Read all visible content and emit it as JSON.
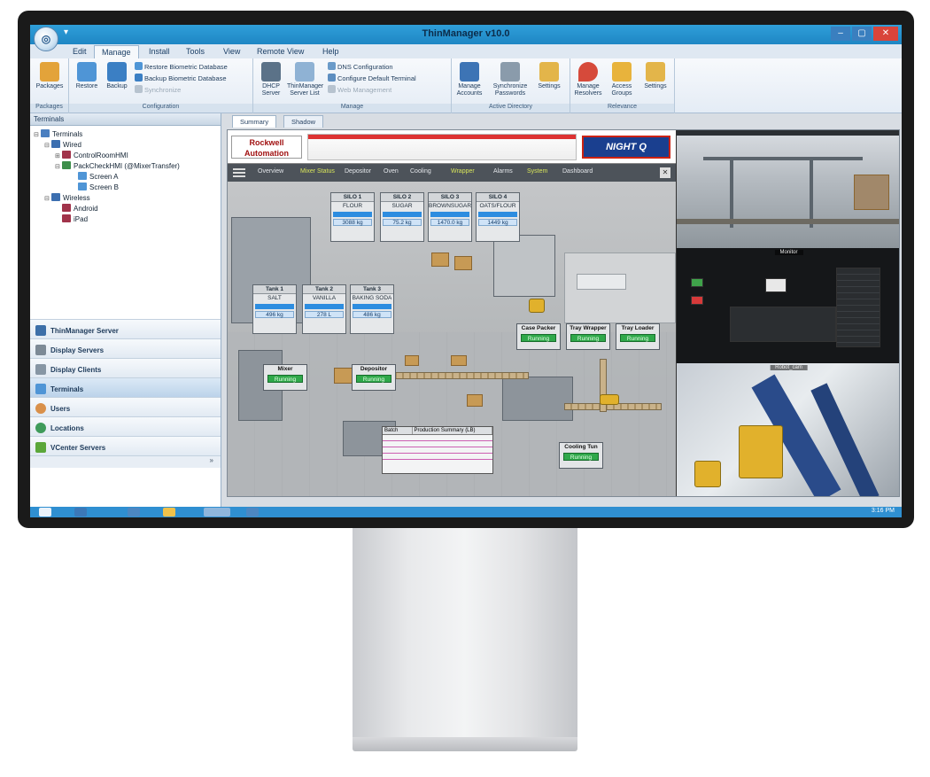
{
  "window": {
    "title": "ThinManager v10.0"
  },
  "menu_tabs": [
    "Edit",
    "Manage",
    "Install",
    "Tools",
    "View",
    "Remote View",
    "Help"
  ],
  "ribbon": {
    "groups": [
      {
        "label": "Packages",
        "buttons": [
          "Packages"
        ]
      },
      {
        "label": "Configuration",
        "buttons": [
          "Restore",
          "Backup"
        ],
        "small": [
          "Restore Biometric Database",
          "Backup Biometric Database",
          "Synchronize"
        ]
      },
      {
        "label": "Manage",
        "buttons": [
          "DHCP Server",
          "ThinManager Server List"
        ],
        "small": [
          "DNS Configuration",
          "Configure Default Terminal",
          "Web Management"
        ]
      },
      {
        "label": "Active Directory",
        "buttons": [
          "Manage Accounts",
          "Synchronize Passwords",
          "Settings"
        ]
      },
      {
        "label": "Relevance",
        "buttons": [
          "Manage Resolvers",
          "Access Groups",
          "Settings"
        ]
      }
    ]
  },
  "left_panel": {
    "header": "Terminals",
    "tree": [
      {
        "label": "Terminals",
        "level": 0
      },
      {
        "label": "Wired",
        "level": 1
      },
      {
        "label": "ControlRoomHMI",
        "level": 2
      },
      {
        "label": "PackCheckHMI (@MixerTransfer)",
        "level": 2
      },
      {
        "label": "Screen A",
        "level": 3
      },
      {
        "label": "Screen B",
        "level": 3
      },
      {
        "label": "Wireless",
        "level": 1
      },
      {
        "label": "Android",
        "level": 2
      },
      {
        "label": "iPad",
        "level": 2
      }
    ],
    "nav": [
      "ThinManager Server",
      "Display Servers",
      "Display Clients",
      "Terminals",
      "Users",
      "Locations",
      "VCenter Servers"
    ],
    "active_nav": "Terminals"
  },
  "content_tabs": [
    "Summary",
    "Shadow"
  ],
  "hmi": {
    "brand": "Rockwell Automation",
    "logo": "NIGHT Q",
    "nav": [
      "Overview",
      "Mixer Status",
      "Depositor",
      "Oven",
      "Cooling",
      "Wrapper",
      "Alarms",
      "System",
      "Dashboard"
    ],
    "silos": [
      {
        "name": "SILO 1",
        "product": "FLOUR",
        "value": "3088 kg"
      },
      {
        "name": "SILO 2",
        "product": "SUGAR",
        "value": "75.2 kg"
      },
      {
        "name": "SILO 3",
        "product": "BROWNSUGAR",
        "value": "1470.0 kg"
      },
      {
        "name": "SILO 4",
        "product": "OATS/FLOUR",
        "value": "1449 kg"
      }
    ],
    "tanks": [
      {
        "name": "Tank 1",
        "product": "SALT",
        "value": "496 kg"
      },
      {
        "name": "Tank 2",
        "product": "VANILLA",
        "value": "278 L"
      },
      {
        "name": "Tank 3",
        "product": "BAKING SODA",
        "value": "486 kg"
      }
    ],
    "stations": [
      {
        "name": "Case Packer",
        "status": "Running"
      },
      {
        "name": "Tray Wrapper",
        "status": "Running"
      },
      {
        "name": "Tray Loader",
        "status": "Running"
      },
      {
        "name": "Mixer",
        "status": "Running"
      },
      {
        "name": "Depositor",
        "status": "Running"
      },
      {
        "name": "Cooling Tun",
        "status": "Running"
      }
    ],
    "table_headers": [
      "Batch",
      "Production Summary (LB)"
    ]
  },
  "cameras": {
    "cam2_label": "Monitor",
    "cam3_label": "Robot_cam"
  },
  "taskbar": {
    "clock": "3:16 PM"
  },
  "colors": {
    "title_blue": "#2f9fd9",
    "status_green": "#2fa84a",
    "accent_blue": "#2d8de0"
  }
}
